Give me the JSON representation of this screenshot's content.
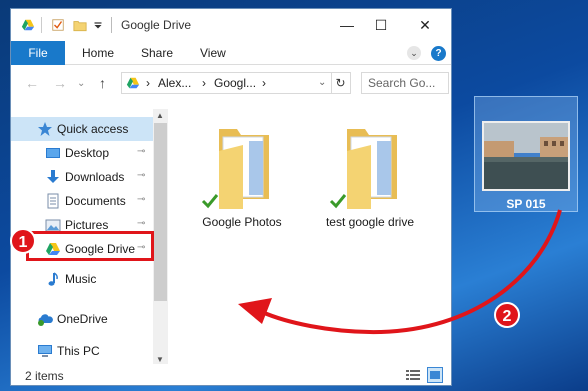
{
  "window": {
    "title": "Google Drive",
    "minimize_glyph": "—",
    "maximize_glyph": "☐",
    "close_glyph": "✕"
  },
  "ribbon": {
    "file_tab": "File",
    "tabs": [
      "Home",
      "Share",
      "View"
    ],
    "help_glyph": "?",
    "expand_glyph": "⌄"
  },
  "address_bar": {
    "back_glyph": "←",
    "forward_glyph": "→",
    "up_glyph": "↑",
    "path": [
      "Alex...",
      "Googl...",
      ""
    ],
    "separator": "›",
    "refresh_glyph": "↻",
    "search_placeholder": "Search Go..."
  },
  "nav_pane": {
    "items": [
      {
        "label": "Quick access",
        "icon": "star-icon",
        "pinned": false
      },
      {
        "label": "Desktop",
        "icon": "desktop-icon",
        "pinned": true
      },
      {
        "label": "Downloads",
        "icon": "download-icon",
        "pinned": true
      },
      {
        "label": "Documents",
        "icon": "documents-icon",
        "pinned": true
      },
      {
        "label": "Pictures",
        "icon": "pictures-icon",
        "pinned": true
      },
      {
        "label": "Google Drive",
        "icon": "google-drive-icon",
        "pinned": true
      },
      {
        "label": "Music",
        "icon": "music-icon",
        "pinned": false
      },
      {
        "label": "OneDrive",
        "icon": "onedrive-icon",
        "pinned": false
      },
      {
        "label": "This PC",
        "icon": "pc-icon",
        "pinned": false
      }
    ],
    "pin_glyph": "📌"
  },
  "content": {
    "folders": [
      {
        "label": "Google Photos",
        "status": "synced"
      },
      {
        "label": "test google drive",
        "status": "synced"
      }
    ]
  },
  "status_bar": {
    "items_count": "2 items"
  },
  "desktop": {
    "icon_label": "SP 015"
  },
  "annotations": {
    "badge_1": "1",
    "badge_2": "2"
  },
  "colors": {
    "accent": "#1979ca",
    "annotation_red": "#e0151a",
    "sync_check": "#3a9a2a",
    "folder": "#f4d372"
  }
}
